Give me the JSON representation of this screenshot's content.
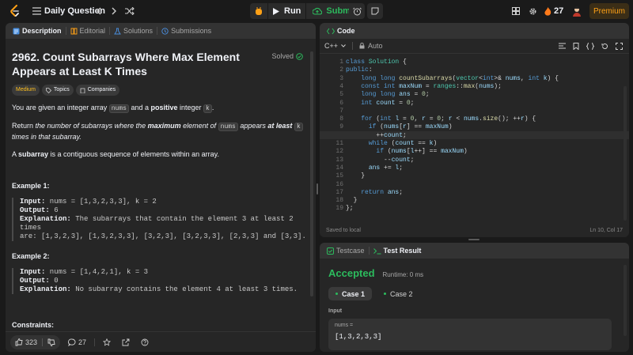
{
  "topbar": {
    "title": "Daily Question",
    "run_label": "Run",
    "submit_label": "Submit",
    "streak": "27",
    "premium_label": "Premium",
    "accent": "#ffa116",
    "submit_color": "#2cbb5d"
  },
  "left": {
    "tabs": [
      {
        "label": "Description",
        "icon": "description-icon"
      },
      {
        "label": "Editorial",
        "icon": "book-icon"
      },
      {
        "label": "Solutions",
        "icon": "flask-icon"
      },
      {
        "label": "Submissions",
        "icon": "clock-icon"
      }
    ],
    "problem_title": "2962. Count Subarrays Where Max Element Appears at Least K Times",
    "solved_label": "Solved",
    "difficulty": "Medium",
    "chips": [
      "Topics",
      "Companies"
    ],
    "p1": {
      "a": "You are given an integer array ",
      "b": "nums",
      "c": " and a ",
      "d": "positive",
      "e": " integer ",
      "f": "k",
      "g": "."
    },
    "p2": {
      "a": "Return ",
      "b": "the number of subarrays where the ",
      "c": "maximum",
      "d": " element of ",
      "e": "nums",
      "f": " appears ",
      "g": "at least",
      "h": "k",
      "i": " times in that subarray."
    },
    "p3": {
      "a": "A ",
      "b": "subarray",
      "c": " is a contiguous sequence of elements within an array."
    },
    "example1": {
      "title": "Example 1:",
      "input_label": "Input:",
      "input": " nums = [1,3,2,3,3], k = 2",
      "output_label": "Output:",
      "output": " 6",
      "expl_label": "Explanation:",
      "expl_1": " The subarrays that contain the element 3 at least 2 times",
      "expl_2": "are: [1,3,2,3], [1,3,2,3,3], [3,2,3], [3,2,3,3], [2,3,3] and [3,3]."
    },
    "example2": {
      "title": "Example 2:",
      "input_label": "Input:",
      "input": " nums = [1,4,2,1], k = 3",
      "output_label": "Output:",
      "output": " 0",
      "expl_label": "Explanation:",
      "expl_1": " No subarray contains the element 4 at least 3 times."
    },
    "constraints_title": "Constraints:",
    "likes": "323",
    "comments": "27"
  },
  "code": {
    "tab_label": "Code",
    "language": "C++",
    "mode": "Auto",
    "status": "Saved to local",
    "cursor": "Ln 10, Col 17",
    "lines": [
      "1",
      "2",
      "3",
      "4",
      "5",
      "6",
      "7",
      "8",
      "9",
      "10",
      "11",
      "12",
      "13",
      "14",
      "15",
      "16",
      "17",
      "18",
      "19"
    ]
  },
  "result": {
    "tabs": [
      {
        "label": "Testcase",
        "icon": "check-box-icon"
      },
      {
        "label": "Test Result",
        "icon": "terminal-icon"
      }
    ],
    "status": "Accepted",
    "runtime": "Runtime: 0 ms",
    "cases": [
      "Case 1",
      "Case 2"
    ],
    "input_title": "Input",
    "var_label": "nums =",
    "var_value": "[1,3,2,3,3]",
    "accepted_color": "#2cbb5d"
  }
}
